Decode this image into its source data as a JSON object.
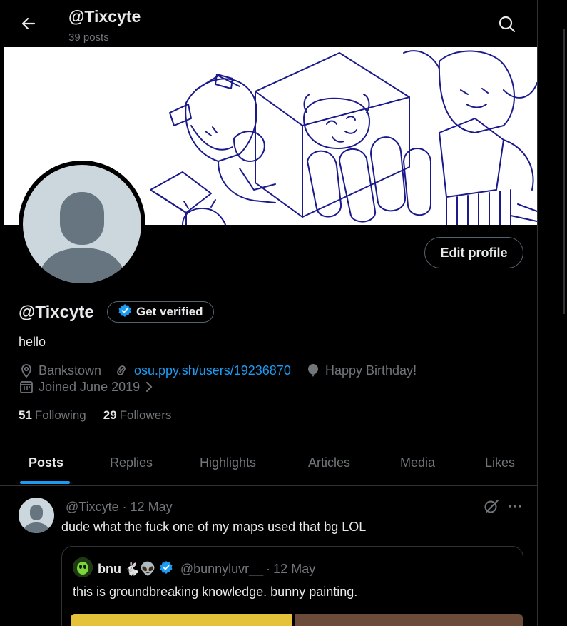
{
  "header": {
    "title": "@Tixcyte",
    "post_count": "39 posts"
  },
  "profile": {
    "display_name": "@Tixcyte",
    "verify_label": "Get verified",
    "edit_label": "Edit profile",
    "bio": "hello",
    "location": "Bankstown",
    "website": "osu.ppy.sh/users/19236870",
    "birthday": "Happy Birthday!",
    "joined": "Joined June 2019",
    "following_count": "51",
    "following_label": "Following",
    "followers_count": "29",
    "followers_label": "Followers"
  },
  "tabs": [
    {
      "label": "Posts",
      "active": true
    },
    {
      "label": "Replies"
    },
    {
      "label": "Highlights"
    },
    {
      "label": "Articles"
    },
    {
      "label": "Media"
    },
    {
      "label": "Likes"
    }
  ],
  "tweet": {
    "author_handle": "@Tixcyte",
    "separator": " · ",
    "date": "12 May",
    "text": "dude what the fuck one of my maps used that bg LOL",
    "quote": {
      "name": "bnu",
      "emoji": "🐇👽",
      "handle": "@bunnyluvr__",
      "date": "12 May",
      "text": "this is groundbreaking knowledge. bunny painting."
    }
  },
  "colors": {
    "accent": "#1d9bf0",
    "muted": "#71767b",
    "text": "#e7e9ea",
    "border": "#2f3336",
    "banner_line": "#1a1a8c"
  },
  "icons": [
    "back-arrow-icon",
    "search-icon",
    "verified-badge-icon",
    "location-pin-icon",
    "link-icon",
    "balloon-icon",
    "calendar-icon",
    "chevron-right-icon",
    "grok-icon",
    "more-icon"
  ]
}
